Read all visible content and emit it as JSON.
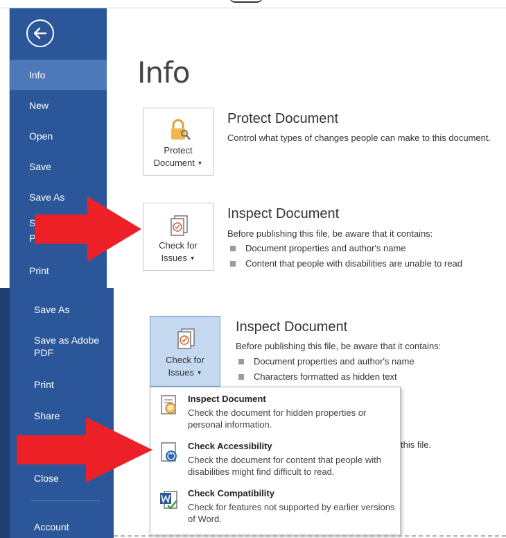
{
  "top": {
    "nav": {
      "info": "Info",
      "new": "New",
      "open": "Open",
      "save": "Save",
      "save_as": "Save As",
      "partial_1": "S",
      "partial_2": "P",
      "print": "Print"
    },
    "page_title": "Info",
    "protect": {
      "button_line1": "Protect",
      "button_line2": "Document",
      "title": "Protect Document",
      "description": "Control what types of changes people can make to this document."
    },
    "inspect": {
      "button_line1": "Check for",
      "button_line2": "Issues",
      "title": "Inspect Document",
      "description": "Before publishing this file, be aware that it contains:",
      "bullets": [
        "Document properties and author's name",
        "Content that people with disabilities are unable to read"
      ]
    }
  },
  "bottom": {
    "nav": {
      "save_as": "Save As",
      "save_as_pdf": "Save as Adobe PDF",
      "print": "Print",
      "share": "Share",
      "close": "Close",
      "account": "Account"
    },
    "inspect": {
      "button_line1": "Check for",
      "button_line2": "Issues",
      "title": "Inspect Document",
      "description": "Before publishing this file, be aware that it contains:",
      "bullets": [
        "Document properties and author's name",
        "Characters formatted as hidden text"
      ]
    },
    "behind_text": "this file.",
    "dropdown": [
      {
        "title": "Inspect Document",
        "description": "Check the document for hidden properties or personal information."
      },
      {
        "title": "Check Accessibility",
        "description": "Check the document for content that people with disabilities might find difficult to read."
      },
      {
        "title": "Check Compatibility",
        "description": "Check for features not supported by earlier versions of Word."
      }
    ]
  },
  "colors": {
    "sidebar": "#2b579a",
    "sidebar_active": "#4e79b8",
    "arrow": "#ee2027",
    "pressed_button": "#c5d9f1"
  },
  "icons": [
    "back-arrow-icon",
    "lock-key-icon",
    "checklist-icon",
    "inspect-document-icon",
    "accessibility-icon",
    "compatibility-icon",
    "dropdown-caret-icon"
  ]
}
